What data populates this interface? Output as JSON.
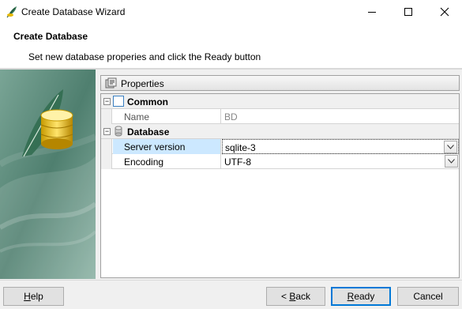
{
  "window": {
    "title": "Create Database Wizard"
  },
  "header": {
    "title": "Create Database",
    "subtitle": "Set new database properies and click the Ready button"
  },
  "properties": {
    "title": "Properties",
    "categories": [
      {
        "label": "Common",
        "expander": "⊟",
        "icon": "page-icon",
        "rows": [
          {
            "name": "Name",
            "value": "BD",
            "disabled": true
          }
        ]
      },
      {
        "label": "Database",
        "expander": "⊟",
        "icon": "database-icon",
        "rows": [
          {
            "name": "Server version",
            "value": "sqlite-3",
            "selected": true
          },
          {
            "name": "Encoding",
            "value": "UTF-8"
          }
        ]
      }
    ]
  },
  "footer": {
    "help_prefix": "H",
    "help_rest": "elp",
    "back_prefix": "< ",
    "back_ul": "B",
    "back_rest": "ack",
    "ready_ul": "R",
    "ready_rest": "eady",
    "cancel_label": "Cancel"
  },
  "colors": {
    "accent": "#0078d7",
    "selection": "#cce8ff",
    "banner": "#5d8a7a"
  }
}
